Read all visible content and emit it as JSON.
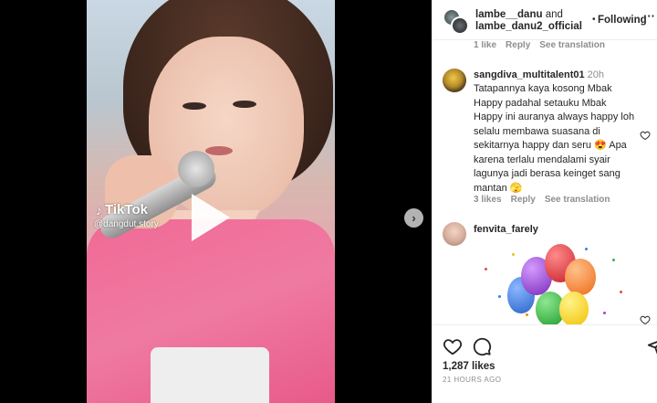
{
  "media": {
    "watermark": "TikTok",
    "watermark_handle": "@dangdut.story",
    "play_icon": "play-icon",
    "next_icon": "chevron-right-icon"
  },
  "header": {
    "user1": "lambe__danu",
    "connector": "and",
    "user2": "lambe_danu2_official",
    "separator": "•",
    "follow_label": "Following",
    "more_icon": "more-icon"
  },
  "comments": {
    "prev_meta": {
      "like": "1 like",
      "reply": "Reply",
      "translate": "See translation"
    },
    "items": [
      {
        "username": "sangdiva_multitalent01",
        "time": "20h",
        "text": "Tatapannya kaya kosong Mbak Happy padahal setauku Mbak Happy ini auranya always happy loh selalu membawa suasana di sekitarnya happy dan seru 😍 Apa karena terlalu mendalami syair lagunya jadi berasa keinget sang mantan 🫣",
        "likes": "3 likes",
        "reply": "Reply",
        "translate": "See translation"
      },
      {
        "username": "fenvita_farely",
        "media": "balloons sticker"
      }
    ]
  },
  "actions": {
    "like_icon": "heart-icon",
    "comment_icon": "comment-icon",
    "share_icon": "share-icon",
    "likes": "1,287 likes",
    "time_ago": "21 HOURS AGO"
  },
  "colors": {
    "accent_text": "#262626",
    "muted": "#8e8e8e",
    "shirt": "#f06a96"
  }
}
